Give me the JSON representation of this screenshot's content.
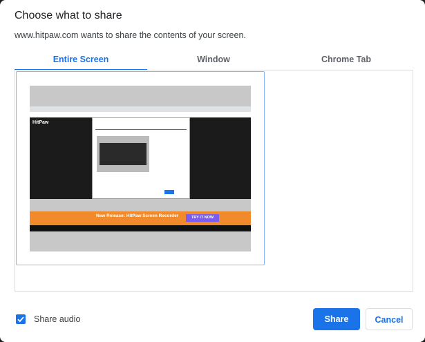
{
  "dialog": {
    "title": "Choose what to share",
    "subtitle": "www.hitpaw.com wants to share the contents of your screen."
  },
  "tabs": [
    {
      "label": "Entire Screen",
      "active": true
    },
    {
      "label": "Window",
      "active": false
    },
    {
      "label": "Chrome Tab",
      "active": false
    }
  ],
  "preview": {
    "logo_text": "HitPaw",
    "banner_text": "New Release: HitPaw Screen Recorder",
    "banner_button": "TRY IT NOW"
  },
  "footer": {
    "share_audio_label": "Share audio",
    "share_audio_checked": true,
    "share_button": "Share",
    "cancel_button": "Cancel"
  },
  "colors": {
    "accent": "#1a73e8",
    "border": "#dadce0"
  }
}
